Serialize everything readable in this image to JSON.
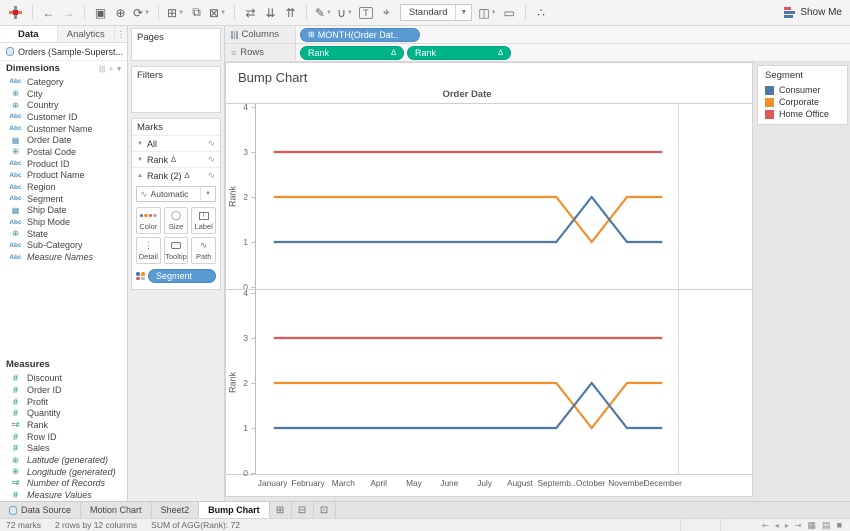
{
  "toolbar": {
    "buttons": [
      {
        "type": "logo",
        "name": "tableau-logo"
      },
      {
        "type": "sep"
      },
      {
        "name": "undo-button",
        "glyph": "←"
      },
      {
        "name": "redo-button",
        "glyph": "→",
        "muted": true
      },
      {
        "type": "sep"
      },
      {
        "name": "save-button",
        "glyph": "▣"
      },
      {
        "name": "new-data-source-button",
        "glyph": "⊕"
      },
      {
        "name": "refresh-data-button",
        "glyph": "⟳",
        "caret": true
      },
      {
        "type": "sep"
      },
      {
        "name": "new-worksheet-button",
        "glyph": "⊞",
        "caret": true
      },
      {
        "name": "duplicate-sheet-button",
        "glyph": "⧉"
      },
      {
        "name": "clear-sheet-button",
        "glyph": "⊠",
        "caret": true
      },
      {
        "type": "sep"
      },
      {
        "name": "swap-rows-columns-button",
        "glyph": "⇄"
      },
      {
        "name": "sort-ascending-button",
        "glyph": "⇊"
      },
      {
        "name": "sort-descending-button",
        "glyph": "⇈"
      },
      {
        "type": "sep"
      },
      {
        "name": "highlight-button",
        "glyph": "✎",
        "caret": true
      },
      {
        "name": "group-members-button",
        "glyph": "∪",
        "caret": true
      },
      {
        "name": "show-mark-labels-button",
        "glyph": "T",
        "boxed": true
      },
      {
        "name": "fix-axes-button",
        "glyph": "⌖"
      }
    ],
    "view_select_value": "Standard",
    "after_select_buttons": [
      {
        "name": "fit-selector-button",
        "glyph": "◫",
        "caret": true
      },
      {
        "name": "presentation-mode-button",
        "glyph": "▭"
      },
      {
        "type": "sep"
      },
      {
        "name": "share-button",
        "glyph": "∴"
      }
    ],
    "show_me_label": "Show Me"
  },
  "data_pane": {
    "tabs": [
      {
        "label": "Data",
        "active": true
      },
      {
        "label": "Analytics",
        "active": false
      }
    ],
    "pane_menu_glyph": "⋮",
    "datasource": "Orders (Sample-Superst...",
    "dimensions": {
      "header": "Dimensions",
      "header_icons": [
        "view-columns-icon",
        "find-field-icon",
        "pane-menu-icon"
      ],
      "fields": [
        {
          "icon": "abc",
          "label": "Category"
        },
        {
          "icon": "globe",
          "label": "City"
        },
        {
          "icon": "globe",
          "label": "Country"
        },
        {
          "icon": "abc",
          "label": "Customer ID"
        },
        {
          "icon": "abc",
          "label": "Customer Name"
        },
        {
          "icon": "calendar",
          "label": "Order Date"
        },
        {
          "icon": "globe",
          "label": "Postal Code"
        },
        {
          "icon": "abc",
          "label": "Product ID"
        },
        {
          "icon": "abc",
          "label": "Product Name"
        },
        {
          "icon": "abc",
          "label": "Region"
        },
        {
          "icon": "abc",
          "label": "Segment"
        },
        {
          "icon": "calendar",
          "label": "Ship Date"
        },
        {
          "icon": "abc",
          "label": "Ship Mode"
        },
        {
          "icon": "globe",
          "label": "State"
        },
        {
          "icon": "abc",
          "label": "Sub-Category"
        },
        {
          "icon": "abc",
          "label": "Measure Names",
          "italic": true
        }
      ]
    },
    "measures": {
      "header": "Measures",
      "fields": [
        {
          "icon": "hash",
          "label": "Discount"
        },
        {
          "icon": "hash",
          "label": "Order ID"
        },
        {
          "icon": "hash",
          "label": "Profit"
        },
        {
          "icon": "hash",
          "label": "Quantity"
        },
        {
          "icon": "calc",
          "label": "Rank"
        },
        {
          "icon": "hash",
          "label": "Row ID"
        },
        {
          "icon": "hash",
          "label": "Sales"
        },
        {
          "icon": "globe-green",
          "label": "Latitude (generated)",
          "italic": true
        },
        {
          "icon": "globe-green",
          "label": "Longitude (generated)",
          "italic": true
        },
        {
          "icon": "calc",
          "label": "Number of Records",
          "italic": true
        },
        {
          "icon": "hash",
          "label": "Measure Values",
          "italic": true
        }
      ]
    }
  },
  "cards": {
    "pages_label": "Pages",
    "filters_label": "Filters",
    "marks_label": "Marks",
    "marks_rows": [
      {
        "label": "All",
        "delta": false,
        "expanded": false
      },
      {
        "label": "Rank",
        "delta": true,
        "expanded": false
      },
      {
        "label": "Rank (2)",
        "delta": true,
        "expanded": true
      }
    ],
    "mark_type": "Automatic",
    "mark_buttons": [
      {
        "name": "color",
        "label": "Color"
      },
      {
        "name": "size",
        "label": "Size"
      },
      {
        "name": "label",
        "label": "Label"
      },
      {
        "name": "detail",
        "label": "Detail"
      },
      {
        "name": "tooltip",
        "label": "Tooltip"
      },
      {
        "name": "path",
        "label": "Path"
      }
    ],
    "marks_pills": [
      {
        "label": "Segment",
        "color": "blue"
      }
    ]
  },
  "shelves": {
    "columns": {
      "label": "Columns",
      "pills": [
        {
          "label": "MONTH(Order Dat..",
          "type": "dimension",
          "icon": "⊞"
        }
      ]
    },
    "rows": {
      "label": "Rows",
      "pills": [
        {
          "label": "Rank",
          "type": "measure",
          "delta": true
        },
        {
          "label": "Rank",
          "type": "measure",
          "delta": true
        }
      ]
    }
  },
  "sheet": {
    "title": "Bump Chart"
  },
  "legend": {
    "title": "Segment",
    "items": [
      {
        "label": "Consumer",
        "color": "#4e79a7"
      },
      {
        "label": "Corporate",
        "color": "#f28e2b"
      },
      {
        "label": "Home Office",
        "color": "#e15759"
      }
    ]
  },
  "chart_data": {
    "type": "line",
    "title": "Bump Chart",
    "column_header": "Order Date",
    "x_categories": [
      "January",
      "February",
      "March",
      "April",
      "May",
      "June",
      "July",
      "August",
      "September",
      "October",
      "November",
      "December"
    ],
    "x_display_labels": [
      "January",
      "February",
      "March",
      "April",
      "May",
      "June",
      "July",
      "August",
      "Septemb..",
      "October",
      "November",
      "December"
    ],
    "ylabel": "Rank",
    "ylim": [
      0,
      4
    ],
    "yticks": [
      4,
      3,
      2,
      1,
      0
    ],
    "panes": 2,
    "panes_note": "two stacked row panes (Rank, Rank) showing identical series",
    "grid": false,
    "legend_position": "right",
    "series": [
      {
        "name": "Home Office",
        "color": "#e15759",
        "values": [
          3,
          3,
          3,
          3,
          3,
          3,
          3,
          3,
          3,
          3,
          3,
          3
        ]
      },
      {
        "name": "Corporate",
        "color": "#f28e2b",
        "values": [
          2,
          2,
          2,
          2,
          2,
          2,
          2,
          2,
          2,
          1,
          2,
          2
        ]
      },
      {
        "name": "Consumer",
        "color": "#4e79a7",
        "values": [
          1,
          1,
          1,
          1,
          1,
          1,
          1,
          1,
          1,
          2,
          1,
          1
        ]
      }
    ]
  },
  "tabs_bar": {
    "tabs": [
      {
        "label": "Data Source",
        "icon": "db",
        "active": false
      },
      {
        "label": "Motion Chart",
        "active": false
      },
      {
        "label": "Sheet2",
        "active": false
      },
      {
        "label": "Bump Chart",
        "active": true
      }
    ],
    "new_buttons": [
      {
        "name": "new-worksheet-tab-button",
        "glyph": "⊞"
      },
      {
        "name": "new-dashboard-button",
        "glyph": "⊟"
      },
      {
        "name": "new-story-button",
        "glyph": "⊡"
      }
    ]
  },
  "status_bar": {
    "marks_count": "72 marks",
    "shape": "2 rows by 12 columns",
    "aggregate": "SUM of AGG(Rank): 72",
    "nav_icons": [
      "⇤",
      "◂",
      "▸",
      "⇥"
    ],
    "view_icons": [
      "▦",
      "▤",
      "■"
    ]
  },
  "colors": {
    "dimension_pill": "#5a99d2",
    "measure_pill": "#00b48a",
    "mark_dot_colors": [
      "#4e79a7",
      "#f28e2b",
      "#e15759",
      "#b5b5b5"
    ]
  }
}
